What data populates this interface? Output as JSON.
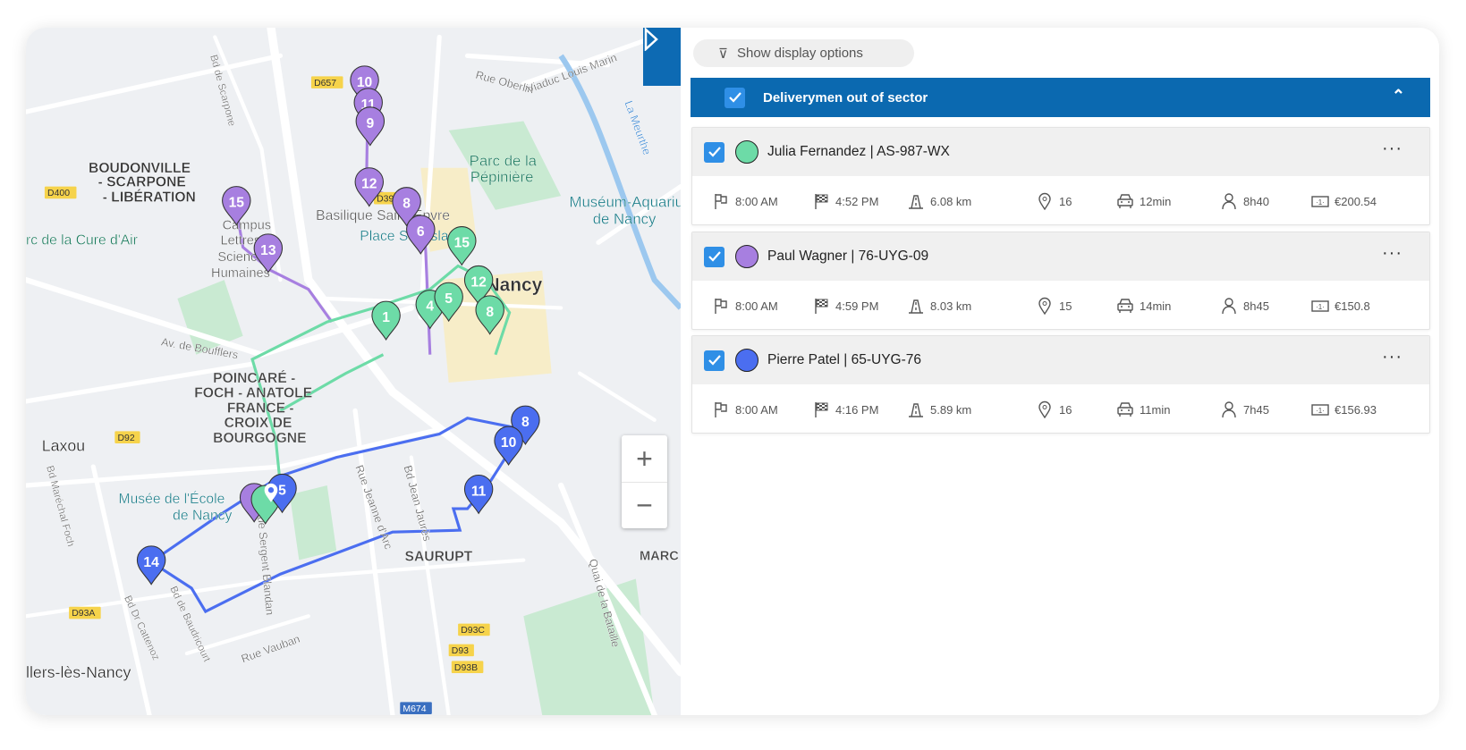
{
  "map": {
    "labels": [
      "BOUDONVILLE",
      "- SCARPONE",
      "- LIBÉRATION",
      "Campus",
      "Lettres et",
      "Sciences",
      "Humaines",
      "rc de la Cure d'Air",
      "Basilique Saint-Epvre",
      "Place Stanislas",
      "Parc de la",
      "Pépinière",
      "Muséum-Aquarium",
      "de Nancy",
      "Nancy",
      "POINCARÉ -",
      "FOCH - ANATOLE",
      "FRANCE -",
      "CROIX DE",
      "BOURGOGNE",
      "Laxou",
      "Musée de l'École",
      "de Nancy",
      "SAURUPT",
      "llers-lès-Nancy",
      "La Meurthe",
      "Rue Oberlin",
      "Viaduc Louis Marin",
      "Bd de Scarpone",
      "Av. de Boufflers",
      "Rue Jeanne d'Arc",
      "Bd Jean Jaurès",
      "Rue Sergent Blandan",
      "Quai de la Bataille",
      "Rue Vauban",
      "Bd Maréchal Foch",
      "Bd Dr Cattenoz",
      "Bd de Baudricourt",
      "MARC",
      "D657",
      "D400",
      "D39",
      "D92",
      "D93A",
      "D93C",
      "D93",
      "D93B",
      "M674"
    ],
    "zoom_in": "+",
    "zoom_out": "−",
    "colors": {
      "green": "#6ddba7",
      "purple": "#a77fe0",
      "blue": "#4b6ef0"
    },
    "markers": {
      "purple": [
        "10",
        "11",
        "9",
        "12",
        "8",
        "6",
        "15",
        "13",
        ""
      ],
      "green": [
        "1",
        "4",
        "5",
        "12",
        "8",
        "15",
        ""
      ],
      "blue": [
        "8",
        "10",
        "11",
        "14",
        "5"
      ]
    }
  },
  "panel": {
    "show_options": "Show display options",
    "group_title": "Deliverymen out of sector",
    "drivers": [
      {
        "name": "Julia Fernandez | AS-987-WX",
        "color": "#6ddba7",
        "start": "8:00 AM",
        "end": "4:52 PM",
        "distance": "6.08 km",
        "stops": "16",
        "drive": "12min",
        "duration": "8h40",
        "cost": "€200.54"
      },
      {
        "name": "Paul Wagner | 76-UYG-09",
        "color": "#a77fe0",
        "start": "8:00 AM",
        "end": "4:59 PM",
        "distance": "8.03 km",
        "stops": "15",
        "drive": "14min",
        "duration": "8h45",
        "cost": "€150.8"
      },
      {
        "name": "Pierre Patel | 65-UYG-76",
        "color": "#4b6ef0",
        "start": "8:00 AM",
        "end": "4:16 PM",
        "distance": "5.89 km",
        "stops": "16",
        "drive": "11min",
        "duration": "7h45",
        "cost": "€156.93"
      }
    ]
  }
}
